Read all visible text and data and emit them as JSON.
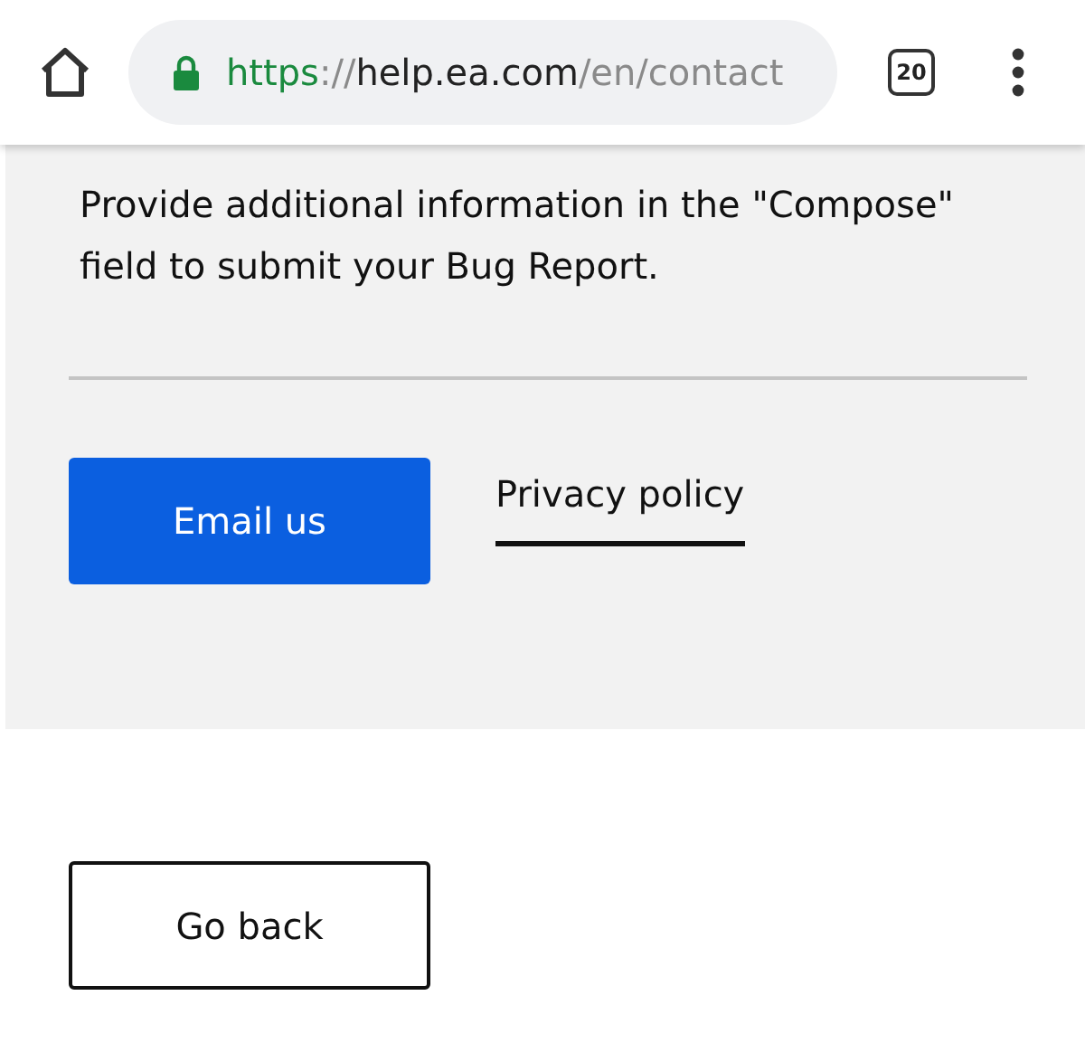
{
  "browser": {
    "url_parts": [
      {
        "kind": "scheme",
        "text": "https"
      },
      {
        "kind": "muted",
        "text": "://"
      },
      {
        "kind": "host",
        "text": "help.ea.com"
      },
      {
        "kind": "muted",
        "text": "/en/contact"
      }
    ],
    "tab_count": "20"
  },
  "panel": {
    "message": "Provide additional information in the \"Compose\" field to submit your Bug Report.",
    "email_button": "Email us",
    "privacy_link": "Privacy policy"
  },
  "back_button": "Go back"
}
